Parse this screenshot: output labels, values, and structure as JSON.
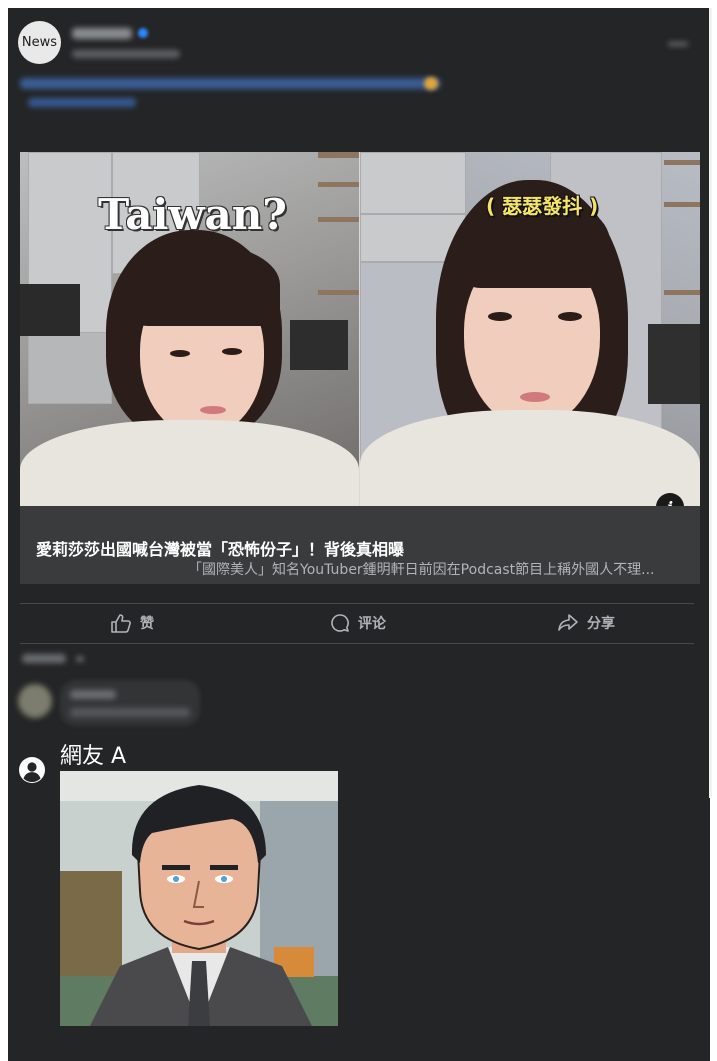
{
  "post": {
    "avatar_label": "News"
  },
  "media": {
    "left_caption": "Taiwan?",
    "right_caption": "( 瑟瑟發抖 )",
    "info_icon": "i"
  },
  "link_preview": {
    "title": "愛莉莎莎出國喊台灣被當「恐怖份子」！背後真相曝",
    "description": "「國際美人」知名YouTuber鍾明軒日前因在Podcast節目上稱外國人不理..."
  },
  "actions": {
    "like": "赞",
    "comment": "评论",
    "share": "分享",
    "like_icon": "thumbs-up-icon",
    "comment_icon": "speech-bubble-icon",
    "share_icon": "share-arrow-icon"
  },
  "reply": {
    "username": "網友 A",
    "avatar_icon": "user-silhouette-icon"
  },
  "colors": {
    "card_bg": "#242526",
    "link_bg": "#3a3b3c",
    "secondary_text": "#b0b3b8"
  }
}
